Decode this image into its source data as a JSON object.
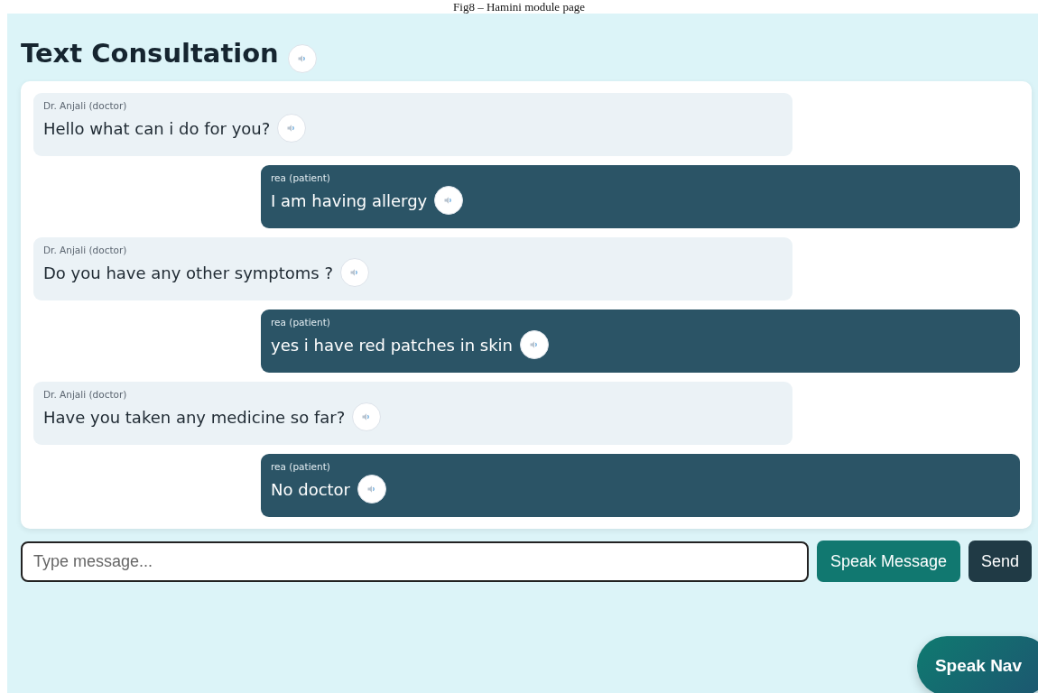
{
  "caption": "Fig8 – Hamini module page",
  "title": "Text Consultation",
  "messages": [
    {
      "kind": "doctor",
      "sender": "Dr. Anjali (doctor)",
      "text": "Hello what can i do for you?"
    },
    {
      "kind": "patient",
      "sender": "rea (patient)",
      "text": "I am having allergy"
    },
    {
      "kind": "doctor",
      "sender": "Dr. Anjali (doctor)",
      "text": "Do you have any other symptoms ?"
    },
    {
      "kind": "patient",
      "sender": "rea (patient)",
      "text": "yes i have red patches in skin"
    },
    {
      "kind": "doctor",
      "sender": "Dr. Anjali (doctor)",
      "text": "Have you taken any medicine so far?"
    },
    {
      "kind": "patient",
      "sender": "rea (patient)",
      "text": "No doctor"
    }
  ],
  "composer": {
    "placeholder": "Type message...",
    "buttons": [
      "Speak Message",
      "Send"
    ]
  },
  "floating_button": "Speak Nav"
}
